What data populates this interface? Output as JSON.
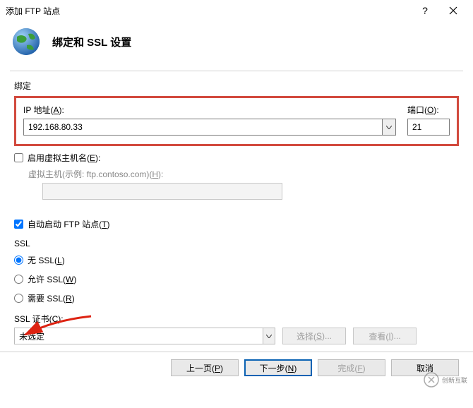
{
  "window": {
    "title": "添加 FTP 站点"
  },
  "header": {
    "title": "绑定和 SSL 设置"
  },
  "binding": {
    "section_label": "绑定",
    "ip_label_pre": "IP 地址(",
    "ip_label_key": "A",
    "ip_label_post": "):",
    "ip_value": "192.168.80.33",
    "port_label_pre": "端口(",
    "port_label_key": "O",
    "port_label_post": "):",
    "port_value": "21"
  },
  "vhost": {
    "enable_label_pre": "启用虚拟主机名(",
    "enable_label_key": "E",
    "enable_label_post": "):",
    "example_label_pre": "虚拟主机(示例: ftp.contoso.com)(",
    "example_label_key": "H",
    "example_label_post": "):",
    "enabled": false
  },
  "autostart": {
    "label_pre": "自动启动 FTP 站点(",
    "label_key": "T",
    "label_post": ")",
    "checked": true
  },
  "ssl": {
    "section_label": "SSL",
    "none_pre": "无 SSL(",
    "none_key": "L",
    "none_post": ")",
    "allow_pre": "允许 SSL(",
    "allow_key": "W",
    "allow_post": ")",
    "require_pre": "需要 SSL(",
    "require_key": "R",
    "require_post": ")",
    "selected": "none",
    "cert_label_pre": "SSL 证书(",
    "cert_label_key": "C",
    "cert_label_post": "):",
    "cert_value": "未选定",
    "select_btn_pre": "选择(",
    "select_btn_key": "S",
    "select_btn_post": ")...",
    "view_btn_pre": "查看(",
    "view_btn_key": "I",
    "view_btn_post": ")..."
  },
  "footer": {
    "prev_pre": "上一页(",
    "prev_key": "P",
    "prev_post": ")",
    "next_pre": "下一步(",
    "next_key": "N",
    "next_post": ")",
    "finish_pre": "完成(",
    "finish_key": "F",
    "finish_post": ")",
    "cancel": "取消"
  },
  "watermark": {
    "text": "创新互联"
  }
}
